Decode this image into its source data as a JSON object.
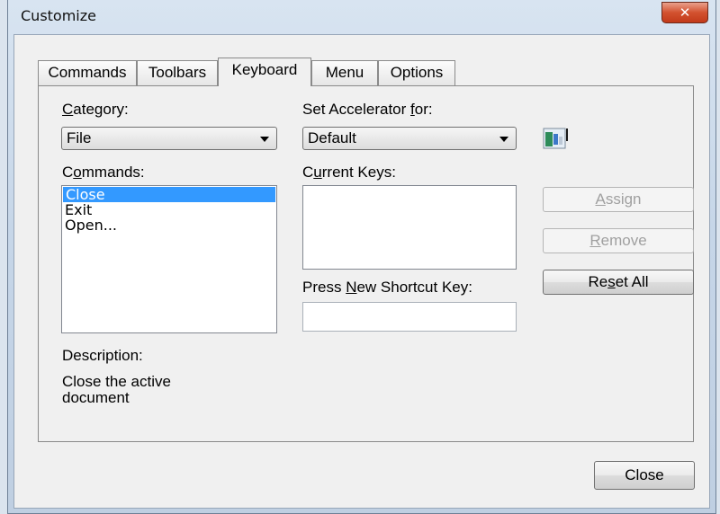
{
  "window": {
    "title": "Customize",
    "close_glyph": "✕"
  },
  "tabs": [
    {
      "label": "Commands"
    },
    {
      "label": "Toolbars"
    },
    {
      "label": "Keyboard"
    },
    {
      "label": "Menu"
    },
    {
      "label": "Options"
    }
  ],
  "active_tab": "Keyboard",
  "category": {
    "label_pre": "",
    "label_u": "C",
    "label_post": "ategory:",
    "value": "File"
  },
  "accelerator": {
    "label_pre": "Set Accelerator ",
    "label_u": "f",
    "label_post": "or:",
    "value": "Default"
  },
  "commands": {
    "label_pre": "C",
    "label_u": "o",
    "label_post": "mmands:",
    "items": [
      {
        "text": "Close",
        "selected": true
      },
      {
        "text": "Exit",
        "selected": false
      },
      {
        "text": "Open...",
        "selected": false
      }
    ]
  },
  "current_keys": {
    "label_pre": "C",
    "label_u": "u",
    "label_post": "rrent Keys:"
  },
  "shortcut": {
    "label_pre": "Press ",
    "label_u": "N",
    "label_post": "ew Shortcut Key:",
    "value": ""
  },
  "buttons": {
    "assign": {
      "pre": "",
      "u": "A",
      "post": "ssign",
      "enabled": false
    },
    "remove": {
      "pre": "",
      "u": "R",
      "post": "emove",
      "enabled": false
    },
    "reset": {
      "pre": "Re",
      "u": "s",
      "post": "et All",
      "enabled": true
    },
    "close": {
      "label": "Close"
    }
  },
  "description": {
    "label": "Description:",
    "text_line1": "Close the active",
    "text_line2": "document"
  },
  "icons": {
    "window_close": "close-icon",
    "command_preview": "toolbar-image-icon",
    "dropdown": "chevron-down-icon"
  },
  "colors": {
    "selection": "#3399ff",
    "close_button": "#c23a1a"
  }
}
